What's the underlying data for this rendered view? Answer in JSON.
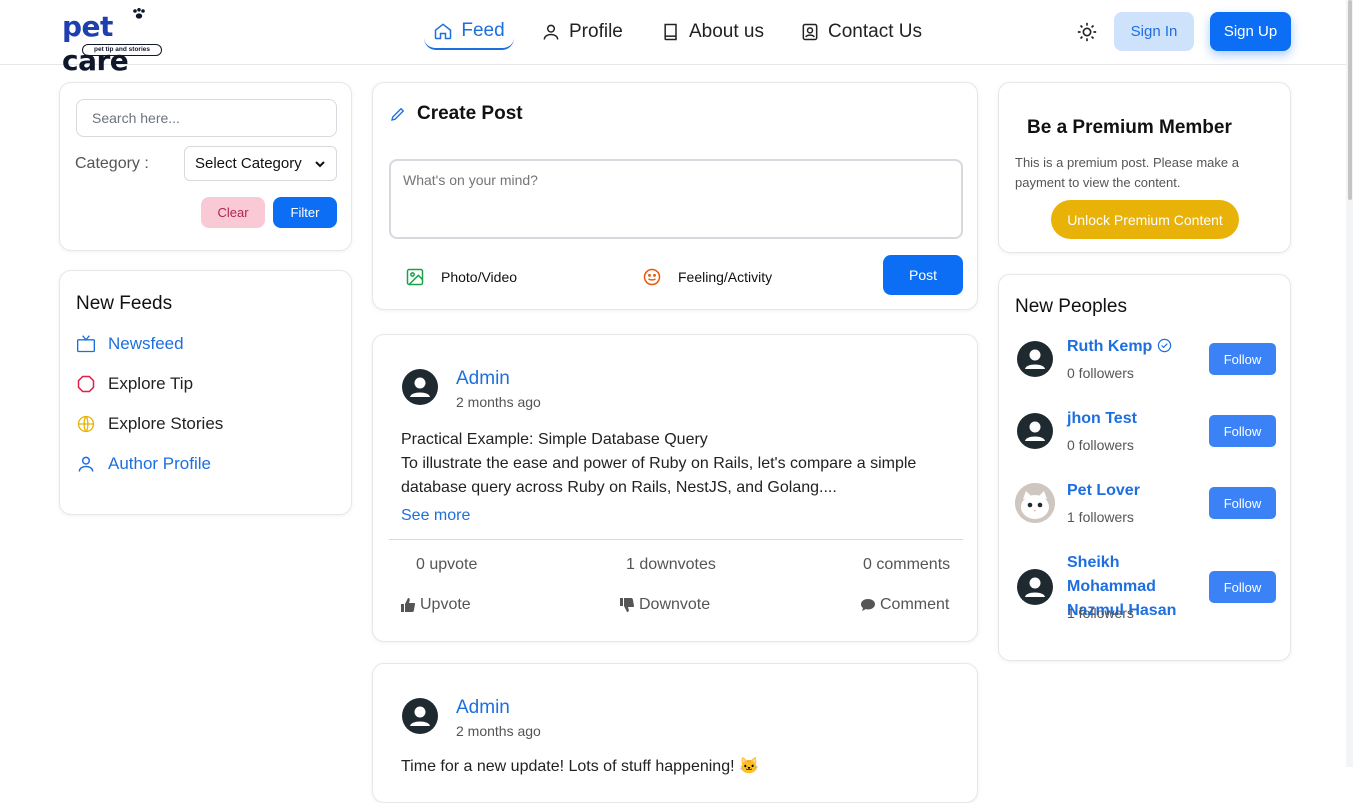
{
  "brand": {
    "word_pet": "pet",
    "word_care": "care",
    "tagline": "pet tip and stories"
  },
  "nav": {
    "feed": "Feed",
    "profile": "Profile",
    "about": "About us",
    "contact": "Contact Us"
  },
  "auth": {
    "signin": "Sign In",
    "signup": "Sign Up"
  },
  "filters": {
    "search_placeholder": "Search here...",
    "category_label": "Category :",
    "category_value": "Select Category",
    "clear": "Clear",
    "filter": "Filter"
  },
  "newfeeds": {
    "title": "New Feeds",
    "items": [
      {
        "label": "Newsfeed",
        "icon": "tv-icon"
      },
      {
        "label": "Explore Tip",
        "icon": "tip-icon"
      },
      {
        "label": "Explore Stories",
        "icon": "globe-icon"
      },
      {
        "label": "Author Profile",
        "icon": "user-icon"
      }
    ]
  },
  "create": {
    "title": "Create Post",
    "placeholder": "What's on your mind?",
    "photo": "Photo/Video",
    "feeling": "Feeling/Activity",
    "post": "Post"
  },
  "posts": [
    {
      "author": "Admin",
      "time": "2 months ago",
      "line1": "Practical Example: Simple Database Query",
      "line2": "To illustrate the ease and power of Ruby on Rails, let's compare a simple database query across Ruby on Rails, NestJS, and Golang....",
      "see_more": "See more",
      "upvotes": "0 upvote",
      "downvotes": "1 downvotes",
      "comments": "0 comments",
      "upvote_btn": "Upvote",
      "downvote_btn": "Downvote",
      "comment_btn": "Comment"
    },
    {
      "author": "Admin",
      "time": "2 months ago",
      "line1": "Time for a new update! Lots of stuff happening! 🐱"
    }
  ],
  "premium": {
    "title": "Be a Premium Member",
    "text": "This is a premium post. Please make a payment to view the content.",
    "unlock": "Unlock Premium Content"
  },
  "people": {
    "title": "New Peoples",
    "follow": "Follow",
    "list": [
      {
        "name": "Ruth Kemp",
        "followers": "0 followers",
        "verified": true
      },
      {
        "name": "jhon Test",
        "followers": "0 followers"
      },
      {
        "name": "Pet Lover",
        "followers": "1 followers"
      },
      {
        "name": "Sheikh Mohammad Nazmul Hasan",
        "followers": "1 followers"
      }
    ]
  },
  "colors": {
    "primary": "#0b6ef4",
    "link": "#1d6fe0",
    "premium": "#e8b208"
  }
}
